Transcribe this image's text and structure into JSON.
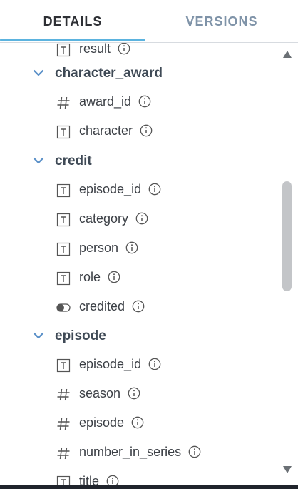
{
  "tabs": {
    "details": "DETAILS",
    "versions": "VERSIONS"
  },
  "colors": {
    "accent": "#5bb3df",
    "active_tab_text": "#2e3035",
    "inactive_tab_text": "#7f93a8",
    "chevron": "#5a90c8"
  },
  "tree": {
    "partial_top": {
      "type": "text",
      "name": "result"
    },
    "character_award": {
      "name": "character_award",
      "fields": [
        {
          "type": "number",
          "name": "award_id"
        },
        {
          "type": "text",
          "name": "character"
        }
      ]
    },
    "credit": {
      "name": "credit",
      "fields": [
        {
          "type": "text",
          "name": "episode_id"
        },
        {
          "type": "text",
          "name": "category"
        },
        {
          "type": "text",
          "name": "person"
        },
        {
          "type": "text",
          "name": "role"
        },
        {
          "type": "boolean",
          "name": "credited"
        }
      ]
    },
    "episode": {
      "name": "episode",
      "fields": [
        {
          "type": "text",
          "name": "episode_id"
        },
        {
          "type": "number",
          "name": "season"
        },
        {
          "type": "number",
          "name": "episode"
        },
        {
          "type": "number",
          "name": "number_in_series"
        },
        {
          "type": "text",
          "name": "title"
        }
      ]
    }
  },
  "icons": {
    "text_type": "text-type-icon",
    "number_type": "hash-icon",
    "boolean_type": "toggle-icon",
    "info": "info-icon",
    "expand": "chevron-down-icon",
    "scroll_up": "arrow-up-icon",
    "scroll_down": "arrow-down-icon"
  }
}
